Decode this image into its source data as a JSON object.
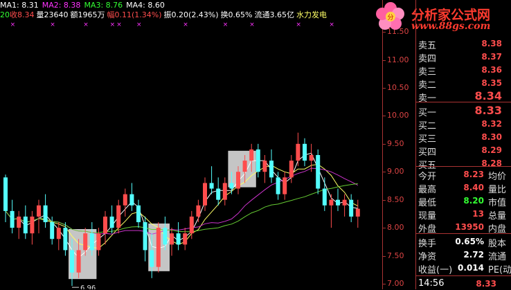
{
  "header": {
    "ma1": "MA1: 8.31",
    "ma2": "MA2: 8.38",
    "ma3": "MA3: 8.76",
    "ma4": "MA4: 8.60",
    "date": "20",
    "close": "收8.34",
    "volume": "量23640",
    "amount": "额1965万",
    "change": "幅0.11(1.34%)",
    "amplitude": "振0.20(2.43%)",
    "turnover": "换0.65%",
    "float_cap": "流通3.65亿",
    "sector": "水力发电"
  },
  "colors": {
    "ma1": "#ffffff",
    "ma2": "#ff33ff",
    "ma3": "#33ff33",
    "ma4": "#ffffff",
    "up": "#ff4d4d",
    "down": "#54ffff",
    "ma_yellow": "#ffff66",
    "ma_magenta": "#cc33cc",
    "ma_green": "#66cc33",
    "ma_white": "#ffffff"
  },
  "logo": {
    "title": "分析家公式网",
    "url": "www.88gs.com"
  },
  "axis_labels": [
    "11.50",
    "11.00",
    "10.50",
    "10.00",
    "9.50",
    "9.00",
    "8.50",
    "8.00",
    "7.50",
    "7.00"
  ],
  "low_marker": "6.96",
  "order_book": {
    "asks": [
      {
        "label": "卖五",
        "price": "8.38"
      },
      {
        "label": "卖四",
        "price": "8.37"
      },
      {
        "label": "卖三",
        "price": "8.36"
      },
      {
        "label": "卖二",
        "price": "8.35"
      },
      {
        "label": "卖一",
        "price": "8.34"
      }
    ],
    "bids": [
      {
        "label": "买一",
        "price": "8.33"
      },
      {
        "label": "买二",
        "price": "8.32"
      },
      {
        "label": "买三",
        "price": "8.30"
      },
      {
        "label": "买四",
        "price": "8.29"
      },
      {
        "label": "买五",
        "price": "8.28"
      }
    ]
  },
  "quote_rows": [
    {
      "label": "今开",
      "value": "8.23",
      "label2": "均价",
      "color": "#ff4d4d"
    },
    {
      "label": "最高",
      "value": "8.40",
      "label2": "量比",
      "color": "#ff4d4d"
    },
    {
      "label": "最低",
      "value": "8.20",
      "label2": "市值",
      "color": "#33ff33"
    },
    {
      "label": "现量",
      "value": "13",
      "label2": "总量",
      "color": "#ff4d4d"
    },
    {
      "label": "外盘",
      "value": "13950",
      "label2": "内盘",
      "color": "#ff4d4d"
    }
  ],
  "stats_rows": [
    {
      "label": "换手",
      "value": "0.65%",
      "label2": "股本"
    },
    {
      "label": "净资",
      "value": "2.72",
      "label2": "流通"
    },
    {
      "label": "收益(一)",
      "value": "0.014",
      "label2": "PE(动"
    }
  ],
  "tick": {
    "time": "14:56",
    "price": "8.33"
  },
  "chart_data": {
    "type": "candlestick",
    "ylim": [
      6.9,
      11.7
    ],
    "candles": [
      [
        8.9,
        8.95,
        8.1,
        8.3
      ],
      [
        8.3,
        8.5,
        7.9,
        8.0
      ],
      [
        8.0,
        8.3,
        7.8,
        8.2
      ],
      [
        8.2,
        8.4,
        7.8,
        7.9
      ],
      [
        7.9,
        8.3,
        7.7,
        8.2
      ],
      [
        8.2,
        8.5,
        7.9,
        8.4
      ],
      [
        8.4,
        8.6,
        8.0,
        8.1
      ],
      [
        8.1,
        8.2,
        7.7,
        7.8
      ],
      [
        7.8,
        8.1,
        7.6,
        8.0
      ],
      [
        8.0,
        8.1,
        7.5,
        7.6
      ],
      [
        7.6,
        7.8,
        6.96,
        7.2
      ],
      [
        7.2,
        7.8,
        7.1,
        7.6
      ],
      [
        7.6,
        8.0,
        7.5,
        7.9
      ],
      [
        7.9,
        8.1,
        7.5,
        7.6
      ],
      [
        7.6,
        8.0,
        7.5,
        7.9
      ],
      [
        7.9,
        8.3,
        7.7,
        8.2
      ],
      [
        8.2,
        8.4,
        7.9,
        8.0
      ],
      [
        8.0,
        8.5,
        7.9,
        8.4
      ],
      [
        8.4,
        8.7,
        8.2,
        8.6
      ],
      [
        8.6,
        8.8,
        8.3,
        8.4
      ],
      [
        8.4,
        8.5,
        8.0,
        8.1
      ],
      [
        8.1,
        8.2,
        7.4,
        7.6
      ],
      [
        7.6,
        7.9,
        7.1,
        7.3
      ],
      [
        7.3,
        8.1,
        7.2,
        8.0
      ],
      [
        8.0,
        8.2,
        7.6,
        7.7
      ],
      [
        7.7,
        8.0,
        7.5,
        7.9
      ],
      [
        7.9,
        8.1,
        7.6,
        7.7
      ],
      [
        7.7,
        8.0,
        7.6,
        7.9
      ],
      [
        7.9,
        8.3,
        7.8,
        8.2
      ],
      [
        8.2,
        8.5,
        8.1,
        8.4
      ],
      [
        8.4,
        8.9,
        8.3,
        8.8
      ],
      [
        8.8,
        9.1,
        8.6,
        8.7
      ],
      [
        8.7,
        8.9,
        8.4,
        8.5
      ],
      [
        8.5,
        8.9,
        8.4,
        8.8
      ],
      [
        8.8,
        9.0,
        8.6,
        8.7
      ],
      [
        8.7,
        9.1,
        8.6,
        9.0
      ],
      [
        9.0,
        9.3,
        8.8,
        9.2
      ],
      [
        9.2,
        9.5,
        9.0,
        9.4
      ],
      [
        9.4,
        9.5,
        8.9,
        9.0
      ],
      [
        9.0,
        9.3,
        8.8,
        9.2
      ],
      [
        9.2,
        9.4,
        8.8,
        8.9
      ],
      [
        8.9,
        9.0,
        8.5,
        8.6
      ],
      [
        8.6,
        9.0,
        8.5,
        8.9
      ],
      [
        8.9,
        9.3,
        8.8,
        9.2
      ],
      [
        9.2,
        9.7,
        9.1,
        9.5
      ],
      [
        9.5,
        9.6,
        9.1,
        9.2
      ],
      [
        9.2,
        9.5,
        9.0,
        9.3
      ],
      [
        9.3,
        9.4,
        8.6,
        8.7
      ],
      [
        8.7,
        8.9,
        8.3,
        8.4
      ],
      [
        8.4,
        8.6,
        8.0,
        8.5
      ],
      [
        8.5,
        8.7,
        8.3,
        8.4
      ],
      [
        8.4,
        8.6,
        8.2,
        8.5
      ],
      [
        8.5,
        8.6,
        8.1,
        8.2
      ],
      [
        8.2,
        8.5,
        8.0,
        8.34
      ]
    ]
  }
}
